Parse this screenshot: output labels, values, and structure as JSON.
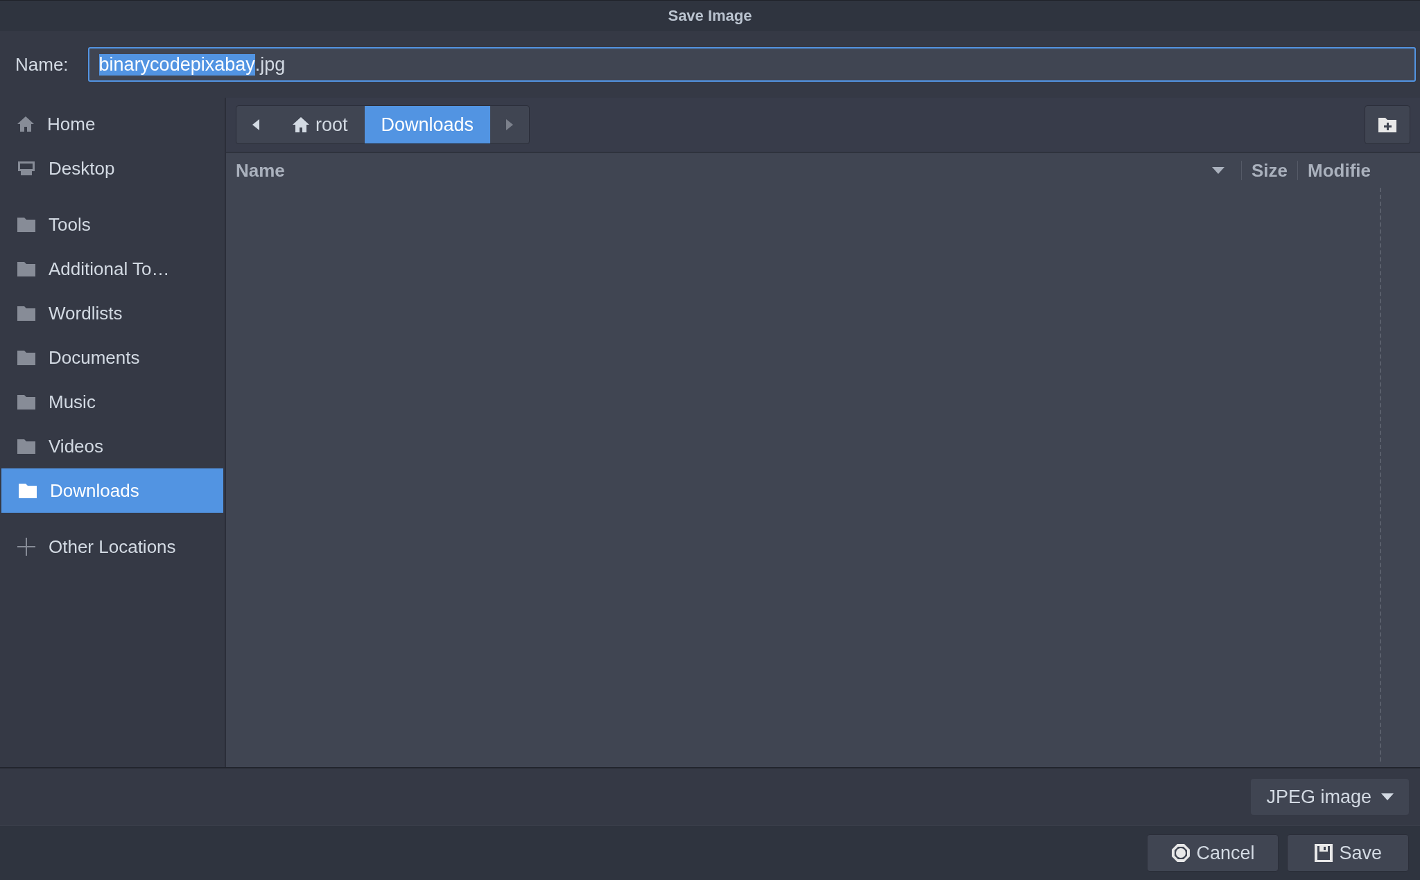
{
  "window": {
    "title": "Save Image"
  },
  "name_row": {
    "label": "Name:",
    "value": [
      {
        "text": "binarycodepixabay",
        "selected": true
      },
      {
        "text": ".jpg",
        "selected": false
      }
    ]
  },
  "sidebar": {
    "sections": [
      [
        {
          "label": "Home",
          "kind": "home",
          "selected": false
        },
        {
          "label": "Desktop",
          "kind": "desktop",
          "selected": false
        }
      ],
      [
        {
          "label": "Tools",
          "kind": "folder",
          "selected": false
        },
        {
          "label": "Additional To…",
          "kind": "folder",
          "selected": false
        },
        {
          "label": "Wordlists",
          "kind": "folder",
          "selected": false
        },
        {
          "label": "Documents",
          "kind": "folder",
          "selected": false
        },
        {
          "label": "Music",
          "kind": "folder",
          "selected": false
        },
        {
          "label": "Videos",
          "kind": "folder",
          "selected": false
        },
        {
          "label": "Downloads",
          "kind": "folder",
          "selected": true
        }
      ],
      [
        {
          "label": "Other Locations",
          "kind": "add",
          "selected": false
        }
      ]
    ]
  },
  "path_bar": {
    "segments": [
      {
        "label": "root",
        "kind": "home",
        "selected": false
      },
      {
        "label": "Downloads",
        "kind": "folder",
        "selected": true
      }
    ]
  },
  "file_list": {
    "columns": [
      {
        "label": "Name",
        "sorted": true
      },
      {
        "label": "Size",
        "sorted": false
      },
      {
        "label": "Modifie",
        "sorted": false
      }
    ]
  },
  "filter": {
    "value": "JPEG image"
  },
  "buttons": [
    {
      "label": "Cancel",
      "kind": "cancel"
    },
    {
      "label": "Save",
      "kind": "save"
    }
  ]
}
